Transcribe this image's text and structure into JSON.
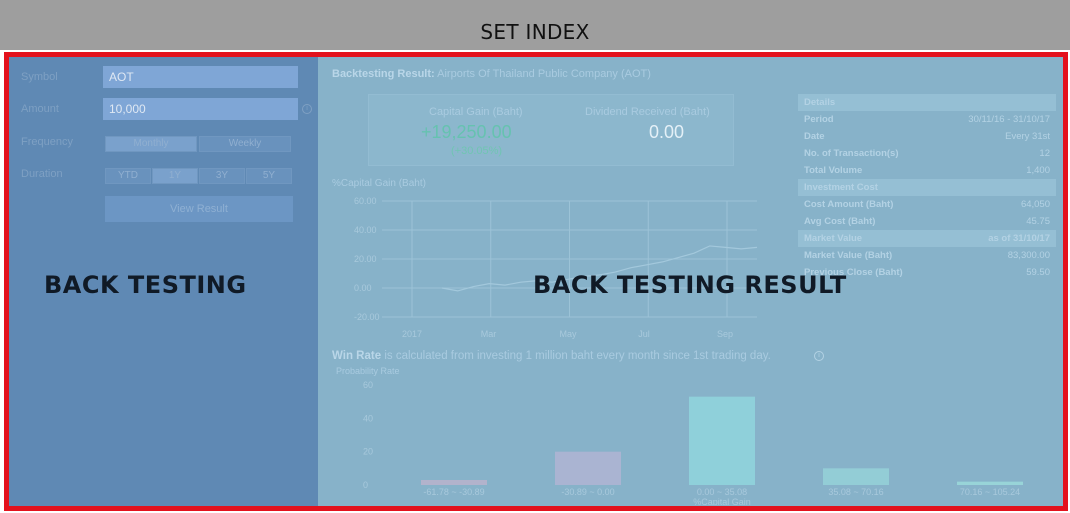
{
  "header": {
    "title": "SET INDEX"
  },
  "form": {
    "symbol_label": "Symbol",
    "symbol_value": "AOT",
    "amount_label": "Amount",
    "amount_value": "10,000",
    "frequency_label": "Frequency",
    "frequency_options": [
      "Monthly",
      "Weekly"
    ],
    "frequency_selected": "Monthly",
    "duration_label": "Duration",
    "duration_options": [
      "YTD",
      "1Y",
      "3Y",
      "5Y"
    ],
    "duration_selected": "1Y",
    "view_button": "View Result",
    "info_icon": "i"
  },
  "overlays": {
    "left": "BACK TESTING",
    "right": "BACK TESTING RESULT"
  },
  "result": {
    "heading_label": "Backtesting Result:",
    "heading_company": "Airports Of Thailand Public Company (AOT)",
    "capital_gain_label": "Capital Gain (Baht)",
    "capital_gain_value": "+19,250.00",
    "capital_gain_pct": "(+30.05%)",
    "dividend_label": "Dividend Received (Baht)",
    "dividend_value": "0.00",
    "chart_title": "%Capital Gain (Baht)",
    "win_rate_bold": "Win Rate",
    "win_rate_text": "is calculated from investing 1 million baht every month since 1st trading day.",
    "probability_label": "Probability Rate"
  },
  "details": [
    {
      "key": "Details",
      "value": "",
      "head": true
    },
    {
      "key": "Period",
      "value": "30/11/16 - 31/10/17"
    },
    {
      "key": "Date",
      "value": "Every 31st"
    },
    {
      "key": "No. of Transaction(s)",
      "value": "12"
    },
    {
      "key": "Total Volume",
      "value": "1,400"
    },
    {
      "key": "Investment Cost",
      "value": "",
      "head": true
    },
    {
      "key": "Cost Amount (Baht)",
      "value": "64,050"
    },
    {
      "key": "Avg Cost (Baht)",
      "value": "45.75"
    },
    {
      "key": "Market Value",
      "value": "as of 31/10/17",
      "head": true
    },
    {
      "key": "Market Value (Baht)",
      "value": "83,300.00"
    },
    {
      "key": "Previous Close (Baht)",
      "value": "59.50"
    }
  ],
  "colors": {
    "frame": "#e3121d",
    "gain": "#4fb3a0",
    "left_panel": "#5f89b4",
    "right_panel": "#87b2c9"
  },
  "chart_data": [
    {
      "type": "line",
      "title": "%Capital Gain (Baht)",
      "x_ticks": [
        "2017",
        "Mar",
        "May",
        "Jul",
        "Sep"
      ],
      "y_ticks": [
        60,
        40,
        20,
        0,
        -20
      ],
      "ylim": [
        -20,
        60
      ],
      "grid": true,
      "series": [
        {
          "x": [
            0,
            0.05,
            0.1,
            0.15,
            0.2,
            0.25,
            0.3,
            0.35,
            0.4,
            0.45,
            0.5,
            0.55,
            0.6,
            0.65,
            0.7,
            0.75,
            0.8,
            0.85,
            0.9,
            0.95,
            1.0
          ],
          "values": [
            0,
            -2,
            1,
            3,
            2,
            4,
            5,
            4,
            6,
            8,
            9,
            11,
            14,
            16,
            18,
            21,
            24,
            29,
            28,
            27,
            28
          ]
        }
      ]
    },
    {
      "type": "bar",
      "ylabel": "Probability Rate",
      "xlabel": "%Capital Gain",
      "categories": [
        "-61.78 ~ -30.89",
        "-30.89 ~ 0.00",
        "0.00 ~ 35.08",
        "35.08 ~ 70.16",
        "70.16 ~ 105.24"
      ],
      "values": [
        3,
        20,
        53,
        10,
        2
      ],
      "y_ticks": [
        0,
        20,
        40,
        60
      ],
      "ylim": [
        0,
        60
      ]
    }
  ]
}
